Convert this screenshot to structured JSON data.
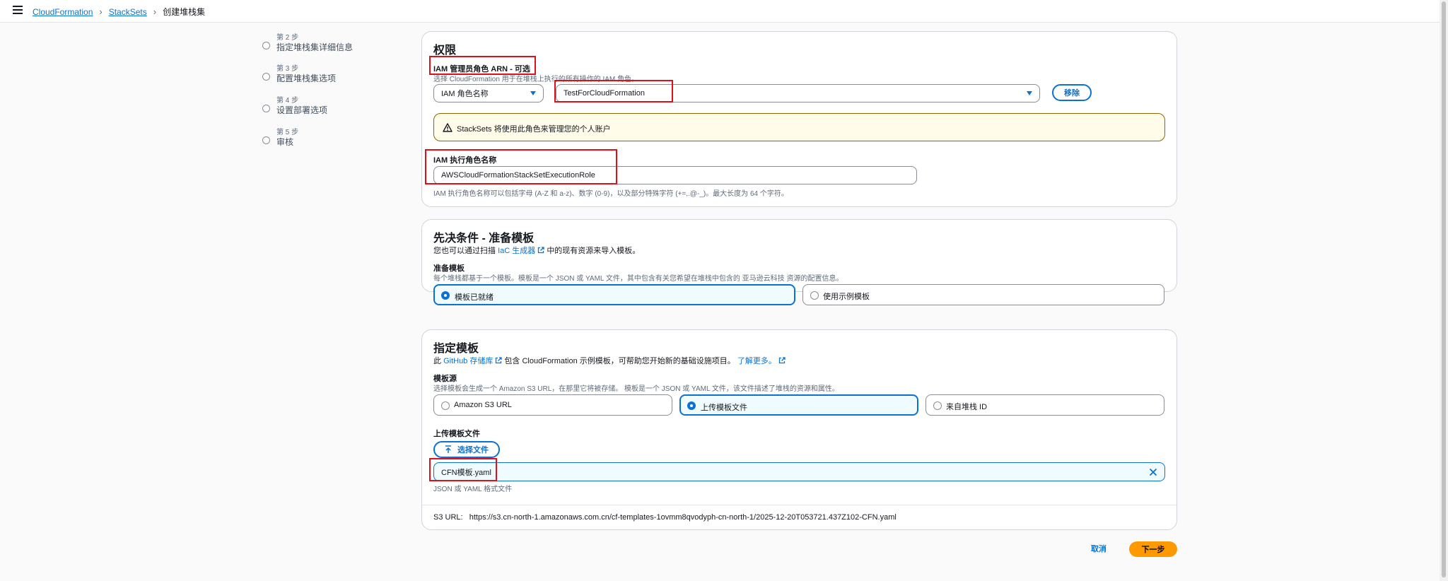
{
  "breadcrumb": {
    "items": [
      "CloudFormation",
      "StackSets"
    ],
    "current": "创建堆栈集"
  },
  "steps": [
    {
      "num": "第 2 步",
      "name": "指定堆栈集详细信息"
    },
    {
      "num": "第 3 步",
      "name": "配置堆栈集选项"
    },
    {
      "num": "第 4 步",
      "name": "设置部署选项"
    },
    {
      "num": "第 5 步",
      "name": "审核"
    }
  ],
  "permissions": {
    "title": "权限",
    "admin_label": "IAM 管理员角色 ARN - 可选",
    "admin_desc": "选择 CloudFormation 用于在堆栈上执行的所有操作的 IAM 角色。",
    "role_type": "IAM 角色名称",
    "role_value": "TestForCloudFormation",
    "remove_button": "移除",
    "warning": "StackSets 将使用此角色来管理您的个人账户",
    "exec_label": "IAM 执行角色名称",
    "exec_value": "AWSCloudFormationStackSetExecutionRole",
    "exec_desc": "IAM 执行角色名称可以包括字母 (A-Z 和 a-z)、数字 (0-9)，以及部分特殊字符 (+=,.@-_)。最大长度为 64 个字符。"
  },
  "prereq": {
    "title": "先决条件 - 准备模板",
    "intro_before": "您也可以通过扫描",
    "intro_link": "IaC 生成器",
    "intro_after": "中的现有资源来导入模板。",
    "label": "准备模板",
    "desc": "每个堆栈都基于一个模板。模板是一个 JSON 或 YAML 文件，其中包含有关您希望在堆栈中包含的 亚马逊云科技 资源的配置信息。",
    "options": [
      "模板已就绪",
      "使用示例模板"
    ]
  },
  "template": {
    "title": "指定模板",
    "intro_prefix": "此",
    "intro_link": "GitHub 存储库",
    "intro_mid": "包含 CloudFormation 示例模板，可帮助您开始新的基础设施项目。",
    "learn_more": "了解更多。",
    "source_label": "模板源",
    "source_desc": "选择模板会生成一个 Amazon S3 URL，在那里它将被存储。 模板是一个 JSON 或 YAML 文件，该文件描述了堆栈的资源和属性。",
    "sources": [
      "Amazon S3 URL",
      "上传模板文件",
      "来自堆栈 ID"
    ],
    "upload_label": "上传模板文件",
    "choose_file": "选择文件",
    "file_name": "CFN模板.yaml",
    "file_hint": "JSON 或 YAML 格式文件",
    "s3_label": "S3 URL:",
    "s3_url": "https://s3.cn-north-1.amazonaws.com.cn/cf-templates-1ovmm8qvodyph-cn-north-1/2025-12-20T053721.437Z102-CFN.yaml"
  },
  "footer": {
    "cancel": "取消",
    "next": "下一步"
  }
}
